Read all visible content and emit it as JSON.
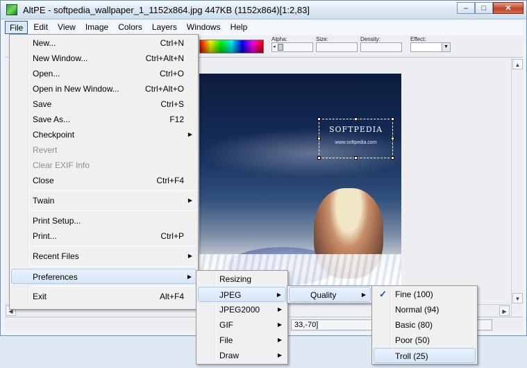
{
  "window": {
    "title": "AltPE - softpedia_wallpaper_1_1152x864.jpg 447KB (1152x864)[1:2,83]",
    "buttons": {
      "minimize": "–",
      "maximize": "□",
      "close": "✕"
    }
  },
  "menubar": [
    "File",
    "Edit",
    "View",
    "Image",
    "Colors",
    "Layers",
    "Windows",
    "Help"
  ],
  "toolbar": {
    "alpha_label": "Alpha:",
    "size_label": "Size:",
    "density_label": "Density:",
    "effect_label": "Effect:"
  },
  "canvas": {
    "logo": "SOFTPEDIA",
    "logo_url": "www.softpedia.com",
    "watermark": "SOFTPEDIA",
    "watermark_url": "www.softpedia.com"
  },
  "status": {
    "coords": "33,-70]"
  },
  "file_menu": {
    "items": [
      {
        "label": "New...",
        "shortcut": "Ctrl+N"
      },
      {
        "label": "New Window...",
        "shortcut": "Ctrl+Alt+N"
      },
      {
        "label": "Open...",
        "shortcut": "Ctrl+O"
      },
      {
        "label": "Open in New Window...",
        "shortcut": "Ctrl+Alt+O"
      },
      {
        "label": "Save",
        "shortcut": "Ctrl+S"
      },
      {
        "label": "Save As...",
        "shortcut": "F12"
      },
      {
        "label": "Checkpoint",
        "shortcut": ""
      },
      {
        "label": "Revert",
        "shortcut": ""
      },
      {
        "label": "Clear EXIF Info",
        "shortcut": ""
      },
      {
        "label": "Close",
        "shortcut": "Ctrl+F4"
      },
      {
        "label": "Twain",
        "shortcut": ""
      },
      {
        "label": "Print Setup...",
        "shortcut": ""
      },
      {
        "label": "Print...",
        "shortcut": "Ctrl+P"
      },
      {
        "label": "Recent Files",
        "shortcut": ""
      },
      {
        "label": "Preferences",
        "shortcut": ""
      },
      {
        "label": "Exit",
        "shortcut": "Alt+F4"
      }
    ]
  },
  "preferences_menu": [
    "Resizing",
    "JPEG",
    "JPEG2000",
    "GIF",
    "File",
    "Draw"
  ],
  "jpeg_menu": [
    "Quality"
  ],
  "quality_menu": {
    "items": [
      "Fine (100)",
      "Normal (94)",
      "Basic (80)",
      "Poor (50)",
      "Troll (25)"
    ],
    "checked": "Fine (100)"
  }
}
